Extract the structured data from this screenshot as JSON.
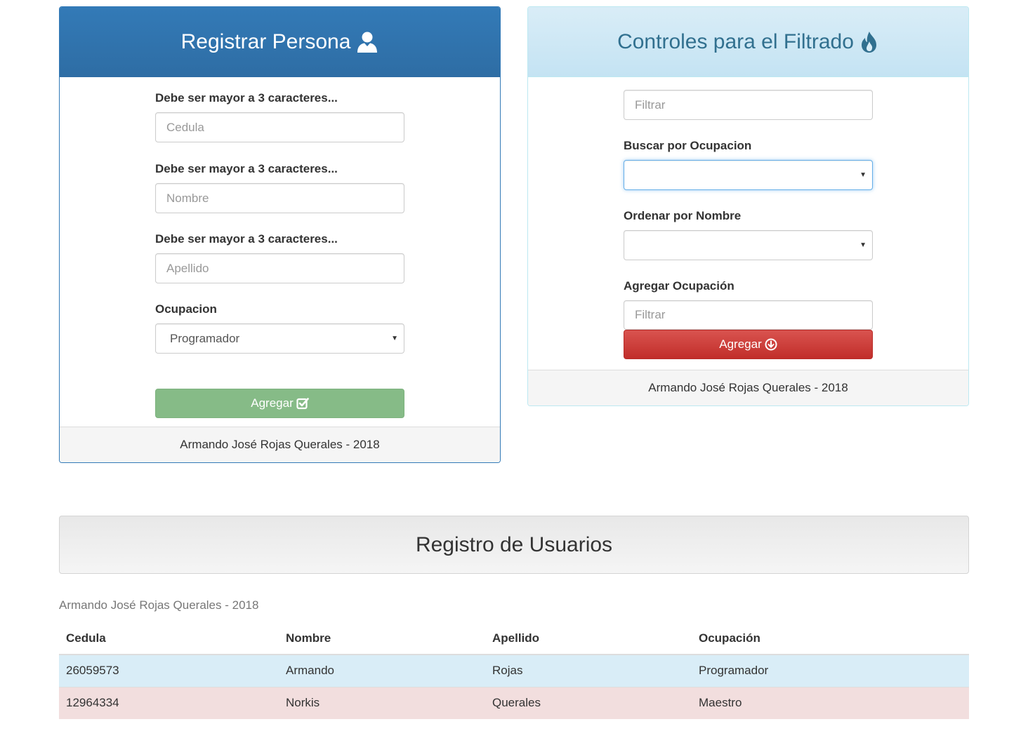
{
  "register_panel": {
    "title": "Registrar Persona",
    "hint_cedula": "Debe ser mayor a 3 caracteres...",
    "cedula_placeholder": "Cedula",
    "hint_nombre": "Debe ser mayor a 3 caracteres...",
    "nombre_placeholder": "Nombre",
    "hint_apellido": "Debe ser mayor a 3 caracteres...",
    "apellido_placeholder": "Apellido",
    "ocupacion_label": "Ocupacion",
    "ocupacion_value": "Programador",
    "submit_label": "Agregar",
    "footer": "Armando José Rojas Querales - 2018"
  },
  "filter_panel": {
    "title": "Controles para el Filtrado",
    "filter_placeholder": "Filtrar",
    "buscar_label": "Buscar por Ocupacion",
    "buscar_value": "",
    "ordenar_label": "Ordenar por Nombre",
    "ordenar_value": "",
    "agregar_ocupacion_label": "Agregar Ocupación",
    "agregar_ocupacion_placeholder": "Filtrar",
    "agregar_button_label": "Agregar",
    "footer": "Armando José Rojas Querales - 2018"
  },
  "registry": {
    "title": "Registro de Usuarios",
    "caption": "Armando José Rojas Querales - 2018",
    "columns": [
      "Cedula",
      "Nombre",
      "Apellido",
      "Ocupación"
    ],
    "rows": [
      [
        "26059573",
        "Armando",
        "Rojas",
        "Programador"
      ],
      [
        "12964334",
        "Norkis",
        "Querales",
        "Maestro"
      ]
    ]
  },
  "icons": {
    "register_title_icon": "user-icon",
    "filter_title_icon": "fire-icon",
    "register_button_icon": "check-square-icon",
    "filter_button_icon": "arrow-circle-down-icon"
  },
  "colors": {
    "primary": "#337ab7",
    "info_bg": "#d9edf7",
    "info_text": "#31708f",
    "success_button": "#86bb87",
    "danger_button": "#d9534f",
    "row_info": "#d9edf7",
    "row_danger": "#f2dede"
  }
}
